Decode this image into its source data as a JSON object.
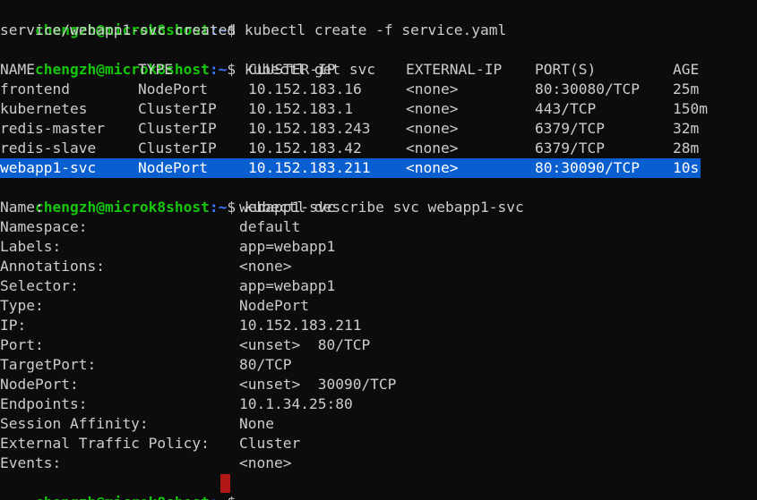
{
  "prompt": {
    "user_host": "chengzh@microk8shost",
    "path": ":~",
    "symbol": "$"
  },
  "commands": {
    "create": " kubectl create -f service.yaml",
    "get": " kubectl get svc",
    "describe": " kubectl describe svc webapp1-svc"
  },
  "create_output": "service/webapp1-svc created",
  "svc_table": {
    "headers": [
      "NAME",
      "TYPE",
      "CLUSTER-IP",
      "EXTERNAL-IP",
      "PORT(S)",
      "AGE"
    ],
    "rows": [
      [
        "frontend",
        "NodePort",
        "10.152.183.16",
        "<none>",
        "80:30080/TCP",
        "25m"
      ],
      [
        "kubernetes",
        "ClusterIP",
        "10.152.183.1",
        "<none>",
        "443/TCP",
        "150m"
      ],
      [
        "redis-master",
        "ClusterIP",
        "10.152.183.243",
        "<none>",
        "6379/TCP",
        "32m"
      ],
      [
        "redis-slave",
        "ClusterIP",
        "10.152.183.42",
        "<none>",
        "6379/TCP",
        "28m"
      ],
      [
        "webapp1-svc",
        "NodePort",
        "10.152.183.211",
        "<none>",
        "80:30090/TCP",
        "10s"
      ]
    ],
    "selected_row": "webapp1-svc"
  },
  "describe": [
    {
      "key": "Name:",
      "value": "webapp1-svc"
    },
    {
      "key": "Namespace:",
      "value": "default"
    },
    {
      "key": "Labels:",
      "value": "app=webapp1"
    },
    {
      "key": "Annotations:",
      "value": "<none>"
    },
    {
      "key": "Selector:",
      "value": "app=webapp1"
    },
    {
      "key": "Type:",
      "value": "NodePort"
    },
    {
      "key": "IP:",
      "value": "10.152.183.211"
    },
    {
      "key": "Port:",
      "value": "<unset>  80/TCP"
    },
    {
      "key": "TargetPort:",
      "value": "80/TCP"
    },
    {
      "key": "NodePort:",
      "value": "<unset>  30090/TCP"
    },
    {
      "key": "Endpoints:",
      "value": "10.1.34.25:80"
    },
    {
      "key": "Session Affinity:",
      "value": "None"
    },
    {
      "key": "External Traffic Policy:",
      "value": "Cluster"
    },
    {
      "key": "Events:",
      "value": "<none>"
    }
  ],
  "colors": {
    "background": "#0c0c0c",
    "text": "#cccccc",
    "prompt_user": "#16c60c",
    "prompt_path": "#3b78ff",
    "selection": "#0a5fd0",
    "cursor": "#b01818"
  }
}
